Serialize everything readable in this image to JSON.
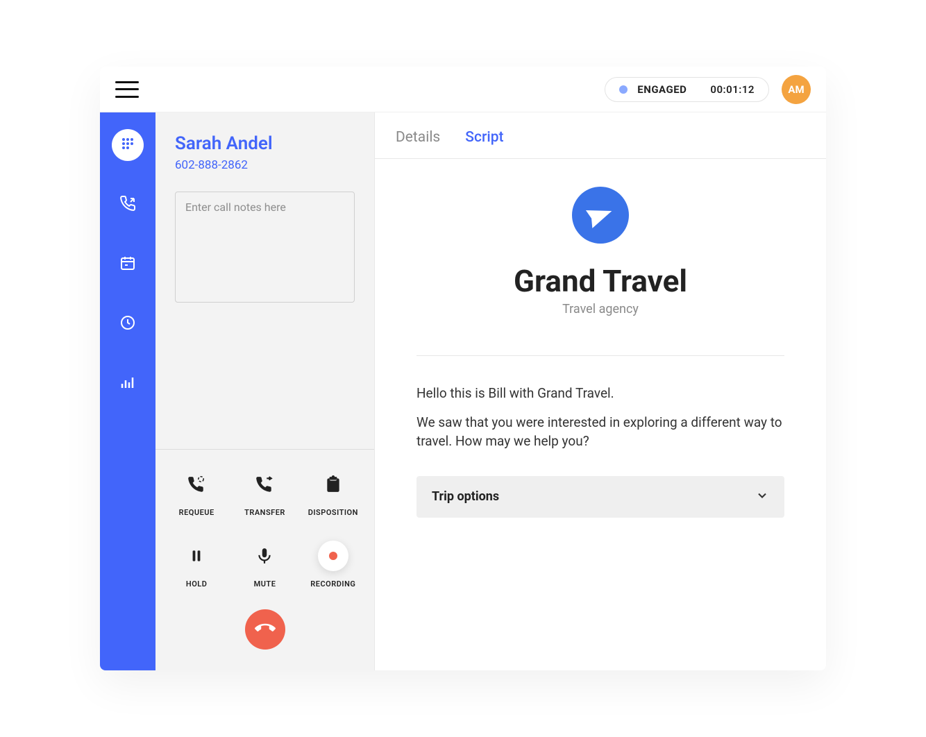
{
  "topbar": {
    "status_label": "ENGAGED",
    "status_time": "00:01:12",
    "avatar_initials": "AM"
  },
  "sidebar": {
    "items": [
      {
        "name": "dialpad",
        "active": true
      },
      {
        "name": "call-log"
      },
      {
        "name": "calendar"
      },
      {
        "name": "clock"
      },
      {
        "name": "stats"
      }
    ]
  },
  "call": {
    "caller_name": "Sarah Andel",
    "caller_phone": "602-888-2862",
    "notes_placeholder": "Enter call notes here",
    "actions": {
      "requeue": "REQUEUE",
      "transfer": "TRANSFER",
      "disposition": "DISPOSITION",
      "hold": "HOLD",
      "mute": "MUTE",
      "recording": "RECORDING"
    }
  },
  "main": {
    "tabs": {
      "details": "Details",
      "script": "Script",
      "active": "script"
    },
    "brand": {
      "title": "Grand Travel",
      "subtitle": "Travel agency"
    },
    "script_lines": [
      "Hello this is Bill with Grand Travel.",
      "We saw that you were interested in exploring a different way to travel. How may we help you?"
    ],
    "dropdown_label": "Trip options"
  },
  "colors": {
    "primary": "#4265fa",
    "accent": "#f0624d",
    "avatar": "#f4a340"
  }
}
